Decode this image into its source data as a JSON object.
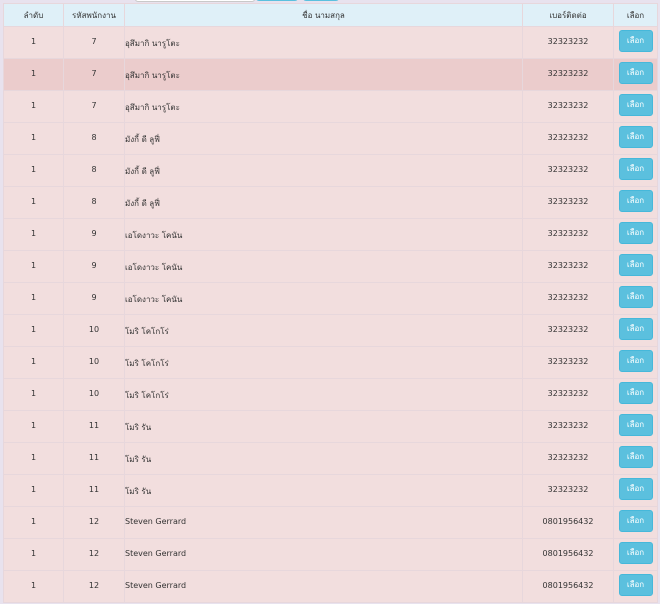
{
  "table": {
    "headers": {
      "order": "ลำดับ",
      "code": "รหัสพนักงาน",
      "name": "ชื่อ นามสกุล",
      "phone": "เบอร์ติดต่อ",
      "select": "เลือก"
    },
    "select_label": "เลือก",
    "rows": [
      {
        "order": "1",
        "code": "7",
        "name": "อุสึมากิ นารูโตะ",
        "phone": "32323232"
      },
      {
        "order": "1",
        "code": "7",
        "name": "อุสึมากิ นารูโตะ",
        "phone": "32323232"
      },
      {
        "order": "1",
        "code": "7",
        "name": "อุสึมากิ นารูโตะ",
        "phone": "32323232"
      },
      {
        "order": "1",
        "code": "8",
        "name": "มังกี้ ดี ลูฟี่",
        "phone": "32323232"
      },
      {
        "order": "1",
        "code": "8",
        "name": "มังกี้ ดี ลูฟี่",
        "phone": "32323232"
      },
      {
        "order": "1",
        "code": "8",
        "name": "มังกี้ ดี ลูฟี่",
        "phone": "32323232"
      },
      {
        "order": "1",
        "code": "9",
        "name": "เอโดงาวะ โคนัน",
        "phone": "32323232"
      },
      {
        "order": "1",
        "code": "9",
        "name": "เอโดงาวะ โคนัน",
        "phone": "32323232"
      },
      {
        "order": "1",
        "code": "9",
        "name": "เอโดงาวะ โคนัน",
        "phone": "32323232"
      },
      {
        "order": "1",
        "code": "10",
        "name": "โมริ โคโกโร่",
        "phone": "32323232"
      },
      {
        "order": "1",
        "code": "10",
        "name": "โมริ โคโกโร่",
        "phone": "32323232"
      },
      {
        "order": "1",
        "code": "10",
        "name": "โมริ โคโกโร่",
        "phone": "32323232"
      },
      {
        "order": "1",
        "code": "11",
        "name": "โมริ รัน",
        "phone": "32323232"
      },
      {
        "order": "1",
        "code": "11",
        "name": "โมริ รัน",
        "phone": "32323232"
      },
      {
        "order": "1",
        "code": "11",
        "name": "โมริ รัน",
        "phone": "32323232"
      },
      {
        "order": "1",
        "code": "12",
        "name": "Steven Gerrard",
        "phone": "0801956432"
      },
      {
        "order": "1",
        "code": "12",
        "name": "Steven Gerrard",
        "phone": "0801956432"
      },
      {
        "order": "1",
        "code": "12",
        "name": "Steven Gerrard",
        "phone": "0801956432"
      }
    ]
  }
}
